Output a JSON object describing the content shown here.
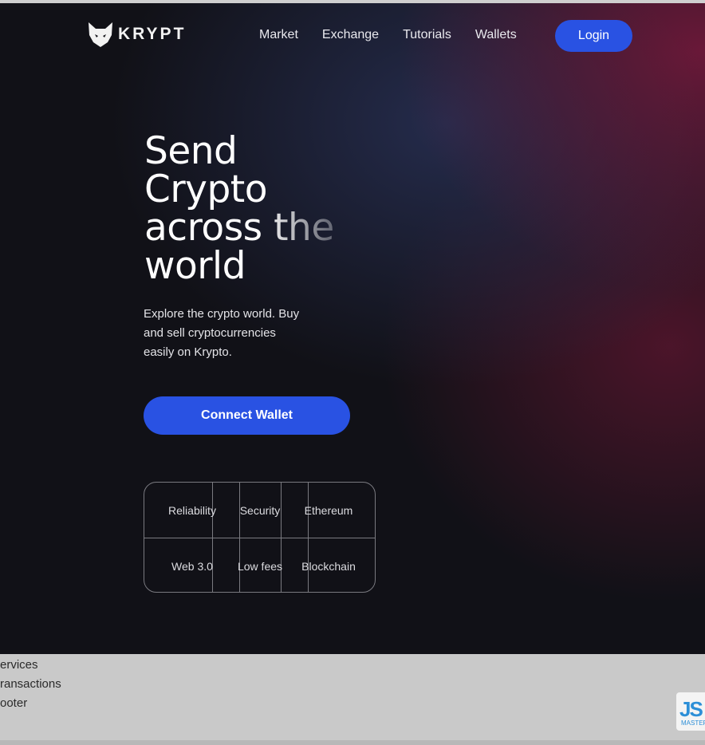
{
  "header": {
    "logo_text": "KRYPT",
    "nav": [
      "Market",
      "Exchange",
      "Tutorials",
      "Wallets"
    ],
    "login_label": "Login"
  },
  "hero": {
    "headline": [
      "Send",
      "Crypto",
      "across the",
      "world"
    ],
    "subtitle": "Explore the crypto world. Buy and sell cryptocurrencies easily on Krypto.",
    "connect_label": "Connect Wallet"
  },
  "features": [
    "Reliability",
    "Security",
    "Ethereum",
    "Web 3.0",
    "Low fees",
    "Blockchain"
  ],
  "sections": [
    "ervices",
    "ransactions",
    "ooter"
  ],
  "badge": {
    "text": "JS",
    "sub": "MASTER"
  },
  "colors": {
    "accent": "#2952e3",
    "background": "#111117",
    "secondary_glow": "#78193c"
  }
}
